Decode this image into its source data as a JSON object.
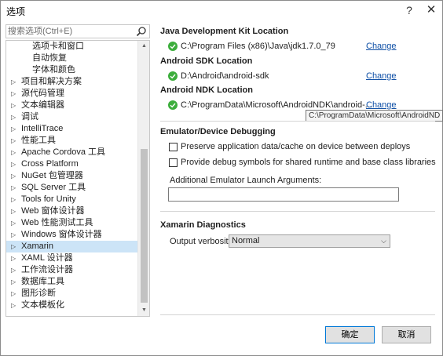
{
  "window": {
    "title": "选项",
    "help_glyph": "?",
    "close_glyph": "✕"
  },
  "search": {
    "placeholder": "搜索选项(Ctrl+E)",
    "icon": "search-icon"
  },
  "tree": {
    "items": [
      {
        "label": "选项卡和窗口",
        "level": "child",
        "expandable": false
      },
      {
        "label": "自动恢复",
        "level": "child",
        "expandable": false
      },
      {
        "label": "字体和颜色",
        "level": "child",
        "expandable": false
      },
      {
        "label": "项目和解决方案",
        "level": "top",
        "expandable": true
      },
      {
        "label": "源代码管理",
        "level": "top",
        "expandable": true
      },
      {
        "label": "文本编辑器",
        "level": "top",
        "expandable": true
      },
      {
        "label": "调试",
        "level": "top",
        "expandable": true
      },
      {
        "label": "IntelliTrace",
        "level": "top",
        "expandable": true
      },
      {
        "label": "性能工具",
        "level": "top",
        "expandable": true
      },
      {
        "label": "Apache Cordova 工具",
        "level": "top",
        "expandable": true
      },
      {
        "label": "Cross Platform",
        "level": "top",
        "expandable": true
      },
      {
        "label": "NuGet 包管理器",
        "level": "top",
        "expandable": true
      },
      {
        "label": "SQL Server 工具",
        "level": "top",
        "expandable": true
      },
      {
        "label": "Tools for Unity",
        "level": "top",
        "expandable": true
      },
      {
        "label": "Web 窗体设计器",
        "level": "top",
        "expandable": true
      },
      {
        "label": "Web 性能测试工具",
        "level": "top",
        "expandable": true
      },
      {
        "label": "Windows 窗体设计器",
        "level": "top",
        "expandable": true
      },
      {
        "label": "Xamarin",
        "level": "top",
        "expandable": true,
        "selected": true
      },
      {
        "label": "XAML 设计器",
        "level": "top",
        "expandable": true
      },
      {
        "label": "工作流设计器",
        "level": "top",
        "expandable": true
      },
      {
        "label": "数据库工具",
        "level": "top",
        "expandable": true
      },
      {
        "label": "图形诊断",
        "level": "top",
        "expandable": true
      },
      {
        "label": "文本模板化",
        "level": "top",
        "expandable": true
      }
    ],
    "expand_glyph": "▷"
  },
  "jdk": {
    "title": "Java Development Kit Location",
    "path": "C:\\Program Files (x86)\\Java\\jdk1.7.0_79",
    "change": "Change"
  },
  "sdk": {
    "title": "Android SDK Location",
    "path": "D:\\Android\\android-sdk",
    "change": "Change"
  },
  "ndk": {
    "title": "Android NDK Location",
    "path": "C:\\ProgramData\\Microsoft\\AndroidNDK\\android-...",
    "change": "Change",
    "tooltip": "C:\\ProgramData\\Microsoft\\AndroidND"
  },
  "emulator": {
    "title": "Emulator/Device Debugging",
    "opt1": "Preserve application data/cache on device between deploys",
    "opt2": "Provide debug symbols for shared runtime and base class libraries",
    "args_label": "Additional Emulator Launch Arguments:",
    "args_value": ""
  },
  "diagnostics": {
    "title": "Xamarin Diagnostics",
    "verbosity_label": "Output verbosity:",
    "verbosity_value": "Normal"
  },
  "buttons": {
    "ok": "确定",
    "cancel": "取消"
  },
  "colors": {
    "accent": "#0078d7",
    "link": "#0e4fa6",
    "check": "#3cae3c",
    "selected": "#cce4f7"
  }
}
